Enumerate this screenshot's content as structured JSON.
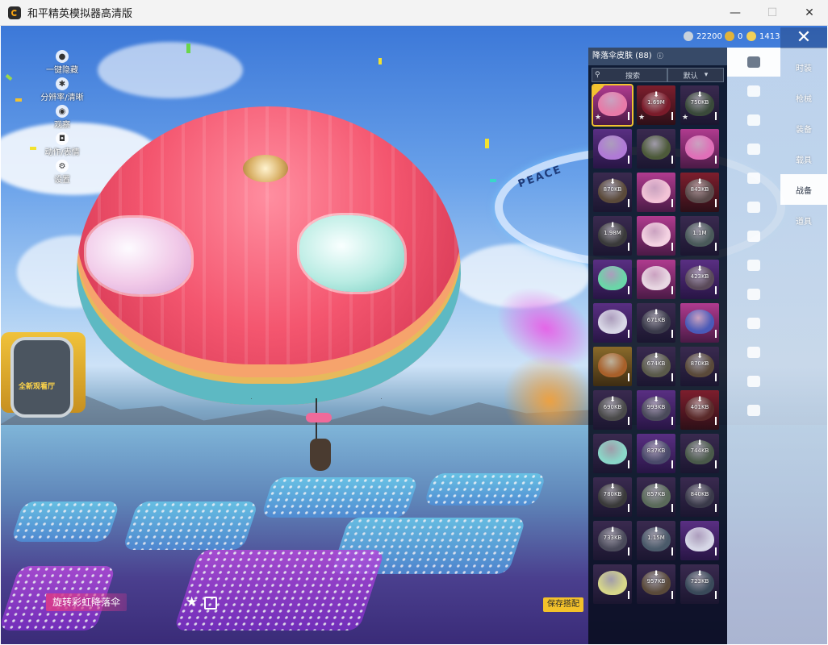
{
  "window": {
    "title": "和平精英模拟器高清版",
    "controls": [
      "—",
      "☐",
      "✕"
    ]
  },
  "currency": [
    {
      "icon": "silver-coin-icon",
      "value": "22200",
      "color": "#c9d2dc"
    },
    {
      "icon": "gold-coin-icon",
      "value": "0",
      "color": "#e2b33a"
    },
    {
      "icon": "diamond-icon",
      "value": "1413",
      "color": "#f0d05a"
    }
  ],
  "left_menu": [
    {
      "icon": "person-icon",
      "label": "一键隐藏"
    },
    {
      "icon": "gear-icon",
      "label": "分辨率/清晰"
    },
    {
      "icon": "eye-icon",
      "label": "观察"
    },
    {
      "icon": "camera-icon",
      "label": "动作/表情"
    },
    {
      "icon": "settings-icon",
      "label": "设置"
    }
  ],
  "booth_label": "全新观看厅",
  "skin_name": "旋转彩虹降落伞",
  "save_button": "保存搭配",
  "panel": {
    "title": "降落伞皮肤 (88)",
    "search_placeholder": "搜索",
    "sort_label": "默认",
    "items": [
      {
        "rarity": "pink",
        "color": "#e87aa8",
        "size": "",
        "star": true,
        "selected": true
      },
      {
        "rarity": "red",
        "color": "#7a1b2a",
        "size": "1.69M",
        "star": true
      },
      {
        "rarity": "default",
        "color": "#3a4a3a",
        "size": "750KB",
        "star": true
      },
      {
        "rarity": "purple",
        "color": "#b07ad6",
        "size": ""
      },
      {
        "rarity": "default",
        "color": "#4d5a3a",
        "size": ""
      },
      {
        "rarity": "pink",
        "color": "#e06fb8",
        "size": ""
      },
      {
        "rarity": "default",
        "color": "#5b4a3a",
        "size": "870KB"
      },
      {
        "rarity": "pink",
        "color": "#f2c2d6",
        "size": ""
      },
      {
        "rarity": "red",
        "color": "#5a4a4a",
        "size": "843KB"
      },
      {
        "rarity": "default",
        "color": "#3a3a3a",
        "size": "1.98M"
      },
      {
        "rarity": "pink",
        "color": "#f4d2e2",
        "size": ""
      },
      {
        "rarity": "default",
        "color": "#4a5a5a",
        "size": "1.1M"
      },
      {
        "rarity": "purple",
        "color": "#6ad6a8",
        "size": ""
      },
      {
        "rarity": "pink",
        "color": "#e8d6e2",
        "size": ""
      },
      {
        "rarity": "purple",
        "color": "#5a4a5a",
        "size": "423KB"
      },
      {
        "rarity": "purple",
        "color": "#d8d6e6",
        "size": ""
      },
      {
        "rarity": "default",
        "color": "#3a3a4a",
        "size": "671KB"
      },
      {
        "rarity": "pink",
        "color": "#4a5ab8",
        "size": ""
      },
      {
        "rarity": "gold",
        "color": "#a8602a",
        "size": ""
      },
      {
        "rarity": "default",
        "color": "#5a5a4a",
        "size": "674KB"
      },
      {
        "rarity": "default",
        "color": "#5a4a3a",
        "size": "870KB"
      },
      {
        "rarity": "default",
        "color": "#4a4a4a",
        "size": "690KB"
      },
      {
        "rarity": "purple",
        "color": "#4a4a5a",
        "size": "993KB"
      },
      {
        "rarity": "red",
        "color": "#5a2a2a",
        "size": "401KB"
      },
      {
        "rarity": "default",
        "color": "#8ad6c8",
        "size": ""
      },
      {
        "rarity": "purple",
        "color": "#4a4a6a",
        "size": "837KB"
      },
      {
        "rarity": "default",
        "color": "#4a5a4a",
        "size": "744KB"
      },
      {
        "rarity": "default",
        "color": "#3a3a3a",
        "size": "780KB"
      },
      {
        "rarity": "default",
        "color": "#5a6a5a",
        "size": "857KB"
      },
      {
        "rarity": "default",
        "color": "#3a3a4a",
        "size": "840KB"
      },
      {
        "rarity": "default",
        "color": "#4a4a5a",
        "size": "733KB"
      },
      {
        "rarity": "default",
        "color": "#4a5a6a",
        "size": "1.15M"
      },
      {
        "rarity": "purple",
        "color": "#d6d6e6",
        "size": ""
      },
      {
        "rarity": "default",
        "color": "#d6d68a",
        "size": ""
      },
      {
        "rarity": "default",
        "color": "#5a4a3a",
        "size": "957KB"
      },
      {
        "rarity": "default",
        "color": "#3a4a5a",
        "size": "723KB"
      }
    ]
  },
  "side_tabs": [
    {
      "label": "时装",
      "active": false
    },
    {
      "label": "枪械",
      "active": false
    },
    {
      "label": "装备",
      "active": false
    },
    {
      "label": "载具",
      "active": false
    },
    {
      "label": "战备",
      "active": true
    },
    {
      "label": "道具",
      "active": false
    }
  ],
  "side_icons": [
    "parachute-icon",
    "plane-icon",
    "drone-icon",
    "jet-icon",
    "face-icon",
    "robot-icon",
    "speaker-icon",
    "badge-icon",
    "picture-icon",
    "spray-icon",
    "hand-icon",
    "wand-icon",
    "hat-icon"
  ],
  "ring_text": "PEACE",
  "colors": {
    "panel_bg": "#080e1e",
    "accent_yellow": "#f3c12a",
    "skin_name_bg": "#d43a8e"
  }
}
